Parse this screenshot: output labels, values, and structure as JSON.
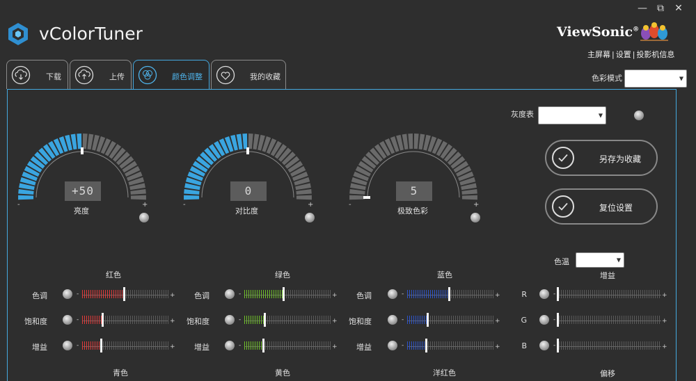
{
  "app": {
    "title": "vColorTuner"
  },
  "window_controls": {
    "minimize": "—",
    "restore": "⧉",
    "close": "✕"
  },
  "brand": {
    "name": "ViewSonic",
    "reg": "®"
  },
  "top_links": {
    "home": "主屏幕",
    "settings": "设置",
    "projector_info": "投影机信息",
    "sep": "|"
  },
  "color_mode": {
    "label": "色彩模式",
    "value": ""
  },
  "tabs": [
    {
      "label": "下载",
      "icon": "cloud-download-icon"
    },
    {
      "label": "上传",
      "icon": "cloud-upload-icon"
    },
    {
      "label": "颜色调整",
      "icon": "color-circles-icon",
      "active": true
    },
    {
      "label": "我的收藏",
      "icon": "heart-icon"
    }
  ],
  "grayscale": {
    "label": "灰度表",
    "value": ""
  },
  "gauges": [
    {
      "label": "亮度",
      "display": "+50",
      "level": 0.5,
      "minus": "-",
      "plus": "+"
    },
    {
      "label": "对比度",
      "display": "0",
      "level": 0.5,
      "minus": "-",
      "plus": "+"
    },
    {
      "label": "极致色彩",
      "display": "5",
      "level": 0.0,
      "minus": "-",
      "plus": "+"
    }
  ],
  "buttons": {
    "save_favorite": "另存为收藏",
    "reset_settings": "复位设置"
  },
  "color_temp": {
    "label": "色温",
    "value": ""
  },
  "sections": [
    {
      "title": "红色",
      "color": "#e03a3a",
      "rows": [
        {
          "label": "色调",
          "level": 0.48
        },
        {
          "label": "饱和度",
          "level": 0.23
        },
        {
          "label": "增益",
          "level": 0.22
        }
      ]
    },
    {
      "title": "绿色",
      "color": "#6fbf2a",
      "rows": [
        {
          "label": "色调",
          "level": 0.45
        },
        {
          "label": "饱和度",
          "level": 0.23
        },
        {
          "label": "增益",
          "level": 0.22
        }
      ]
    },
    {
      "title": "蓝色",
      "color": "#2e54c8",
      "rows": [
        {
          "label": "色调",
          "level": 0.48
        },
        {
          "label": "饱和度",
          "level": 0.23
        },
        {
          "label": "增益",
          "level": 0.22
        }
      ]
    }
  ],
  "gain": {
    "title": "增益",
    "rows": [
      {
        "label": "R",
        "level": 0.0
      },
      {
        "label": "G",
        "level": 0.0
      },
      {
        "label": "B",
        "level": 0.0
      }
    ]
  },
  "bottom_titles": {
    "cyan": "青色",
    "yellow": "黄色",
    "magenta": "洋红色",
    "offset": "偏移"
  },
  "slider_marks": {
    "minus": "-",
    "plus": "+"
  },
  "colors": {
    "accent": "#45a9e0",
    "gauge_active": "#3aa5e0",
    "gauge_inactive": "#6a6a6a"
  }
}
